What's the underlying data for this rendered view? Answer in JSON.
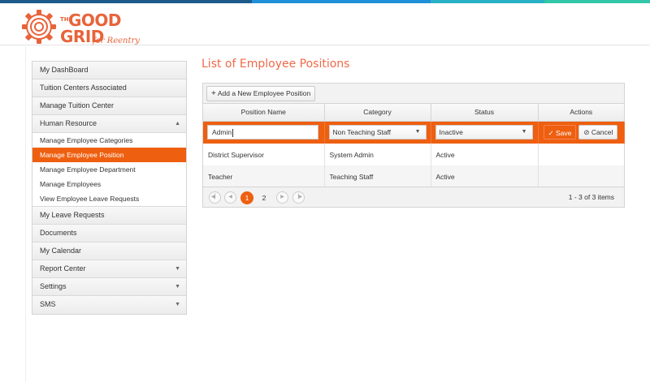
{
  "brand": {
    "logo_the": "THE",
    "logo_good": "GOOD",
    "logo_grid": "GRID",
    "logo_tagline": "for Reentry",
    "accent": "#ee5f10",
    "bar_colors": [
      "#1d5a8a",
      "#1f8fd8",
      "#2ab0c5",
      "#34c6a8"
    ]
  },
  "sidebar": {
    "items": [
      {
        "label": "My DashBoard"
      },
      {
        "label": "Tuition Centers Associated"
      },
      {
        "label": "Manage Tuition Center"
      },
      {
        "label": "Human Resource",
        "arrow": "▲"
      },
      {
        "label": "My Leave Requests"
      },
      {
        "label": "Documents"
      },
      {
        "label": "My Calendar"
      },
      {
        "label": "Report Center",
        "arrow": "▼"
      },
      {
        "label": "Settings",
        "arrow": "▼"
      },
      {
        "label": "SMS",
        "arrow": "▼"
      }
    ],
    "subitems": [
      {
        "label": "Manage Employee Categories"
      },
      {
        "label": "Manage Employee Position",
        "active": true
      },
      {
        "label": "Manage Employee Department"
      },
      {
        "label": "Manage Employees"
      },
      {
        "label": "View Employee Leave Requests"
      }
    ]
  },
  "page_title": "List of Employee Positions",
  "grid": {
    "add_button": "Add a New Employee Position",
    "columns": [
      "Position Name",
      "Category",
      "Status",
      "Actions"
    ],
    "edit_row": {
      "position_name": "Admin",
      "category": "Non Teaching Staff",
      "status": "Inactive",
      "save_label": "Save",
      "cancel_label": "Cancel"
    },
    "rows": [
      {
        "position_name": "District Supervisor",
        "category": "System Admin",
        "status": "Active"
      },
      {
        "position_name": "Teacher",
        "category": "Teaching Staff",
        "status": "Active"
      }
    ],
    "pager": {
      "pages": [
        "1",
        "2"
      ],
      "current": "1",
      "info": "1 - 3 of 3 items"
    }
  }
}
